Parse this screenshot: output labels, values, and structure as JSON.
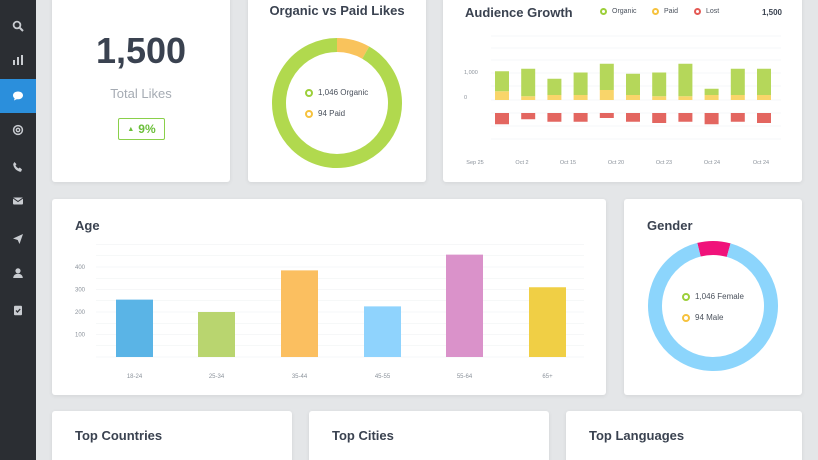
{
  "sidebar": {
    "items": [
      {
        "icon": "search-icon",
        "active": false
      },
      {
        "icon": "bar-chart-icon",
        "active": false
      },
      {
        "icon": "chat-icon",
        "active": true
      },
      {
        "icon": "at-sign-icon",
        "active": false
      },
      {
        "icon": "phone-icon",
        "active": false
      },
      {
        "icon": "mail-icon",
        "active": false
      },
      {
        "icon": "send-icon",
        "active": false
      },
      {
        "icon": "user-icon",
        "active": false
      },
      {
        "icon": "clipboard-check-icon",
        "active": false
      }
    ]
  },
  "total_likes": {
    "value": "1,500",
    "caption": "Total Likes",
    "change": "9%",
    "change_icon": "caret-up-icon"
  },
  "organic_vs_paid": {
    "title": "Organic vs Paid Likes",
    "legend": [
      {
        "label": "1,046 Organic",
        "color": "#9ccf3a"
      },
      {
        "label": "94 Paid",
        "color": "#f6c23e"
      }
    ],
    "chart_data": {
      "type": "pie",
      "title": "Organic vs Paid Likes",
      "slices": [
        {
          "label": "Organic",
          "value": 1046,
          "color": "#b1d94e"
        },
        {
          "label": "Paid",
          "value": 94,
          "color": "#f9c35c"
        }
      ]
    }
  },
  "audience_growth": {
    "title": "Audience Growth",
    "legend": [
      {
        "label": "Organic",
        "color": "#9ccf3a"
      },
      {
        "label": "Paid",
        "color": "#f6c23e"
      },
      {
        "label": "Lost",
        "color": "#e45a55"
      }
    ],
    "total": "1,500",
    "chart_data": {
      "type": "bar",
      "title": "Audience Growth",
      "ylim": [
        -600,
        1600
      ],
      "y_ticks": [
        "1,000",
        "0"
      ],
      "x_ticks": [
        "Sep 25",
        "Oct 2",
        "Oct 15",
        "Oct 20",
        "Oct 23",
        "Oct 24",
        "Oct 24"
      ],
      "series": [
        {
          "name": "Organic",
          "color": "#b5d75a",
          "values": [
            800,
            1100,
            650,
            900,
            1050,
            850,
            950,
            1300,
            250,
            1050,
            1050
          ]
        },
        {
          "name": "Paid",
          "color": "#f9d56a",
          "values": [
            350,
            150,
            200,
            200,
            400,
            200,
            150,
            150,
            200,
            200,
            200
          ]
        },
        {
          "name": "Lost",
          "color": "#e36660",
          "values": [
            -450,
            -250,
            -350,
            -350,
            -200,
            -350,
            -400,
            -350,
            -450,
            -350,
            -400
          ]
        }
      ]
    }
  },
  "age": {
    "title": "Age",
    "chart_data": {
      "type": "bar",
      "title": "Age",
      "ylim": [
        0,
        450
      ],
      "y_ticks": [
        "100",
        "200",
        "300",
        "400"
      ],
      "categories": [
        "18-24",
        "25-34",
        "35-44",
        "45-55",
        "55-64",
        "65+"
      ],
      "values": [
        255,
        200,
        385,
        225,
        455,
        310
      ],
      "colors": [
        "#5ab4e6",
        "#b9d56f",
        "#fbbf60",
        "#8fd3fd",
        "#da92ca",
        "#f0cf45"
      ]
    }
  },
  "gender": {
    "title": "Gender",
    "legend": [
      {
        "label": "1,046 Female",
        "color": "#9ccf3a"
      },
      {
        "label": "94 Male",
        "color": "#f6c23e"
      }
    ],
    "chart_data": {
      "type": "pie",
      "title": "Gender",
      "slices": [
        {
          "label": "Female",
          "value": 1046,
          "color": "#8cd5fc"
        },
        {
          "label": "Male",
          "value": 94,
          "color": "#f0127a"
        }
      ]
    }
  },
  "bottom": {
    "countries_title": "Top Countries",
    "cities_title": "Top Cities",
    "languages_title": "Top Languages"
  }
}
